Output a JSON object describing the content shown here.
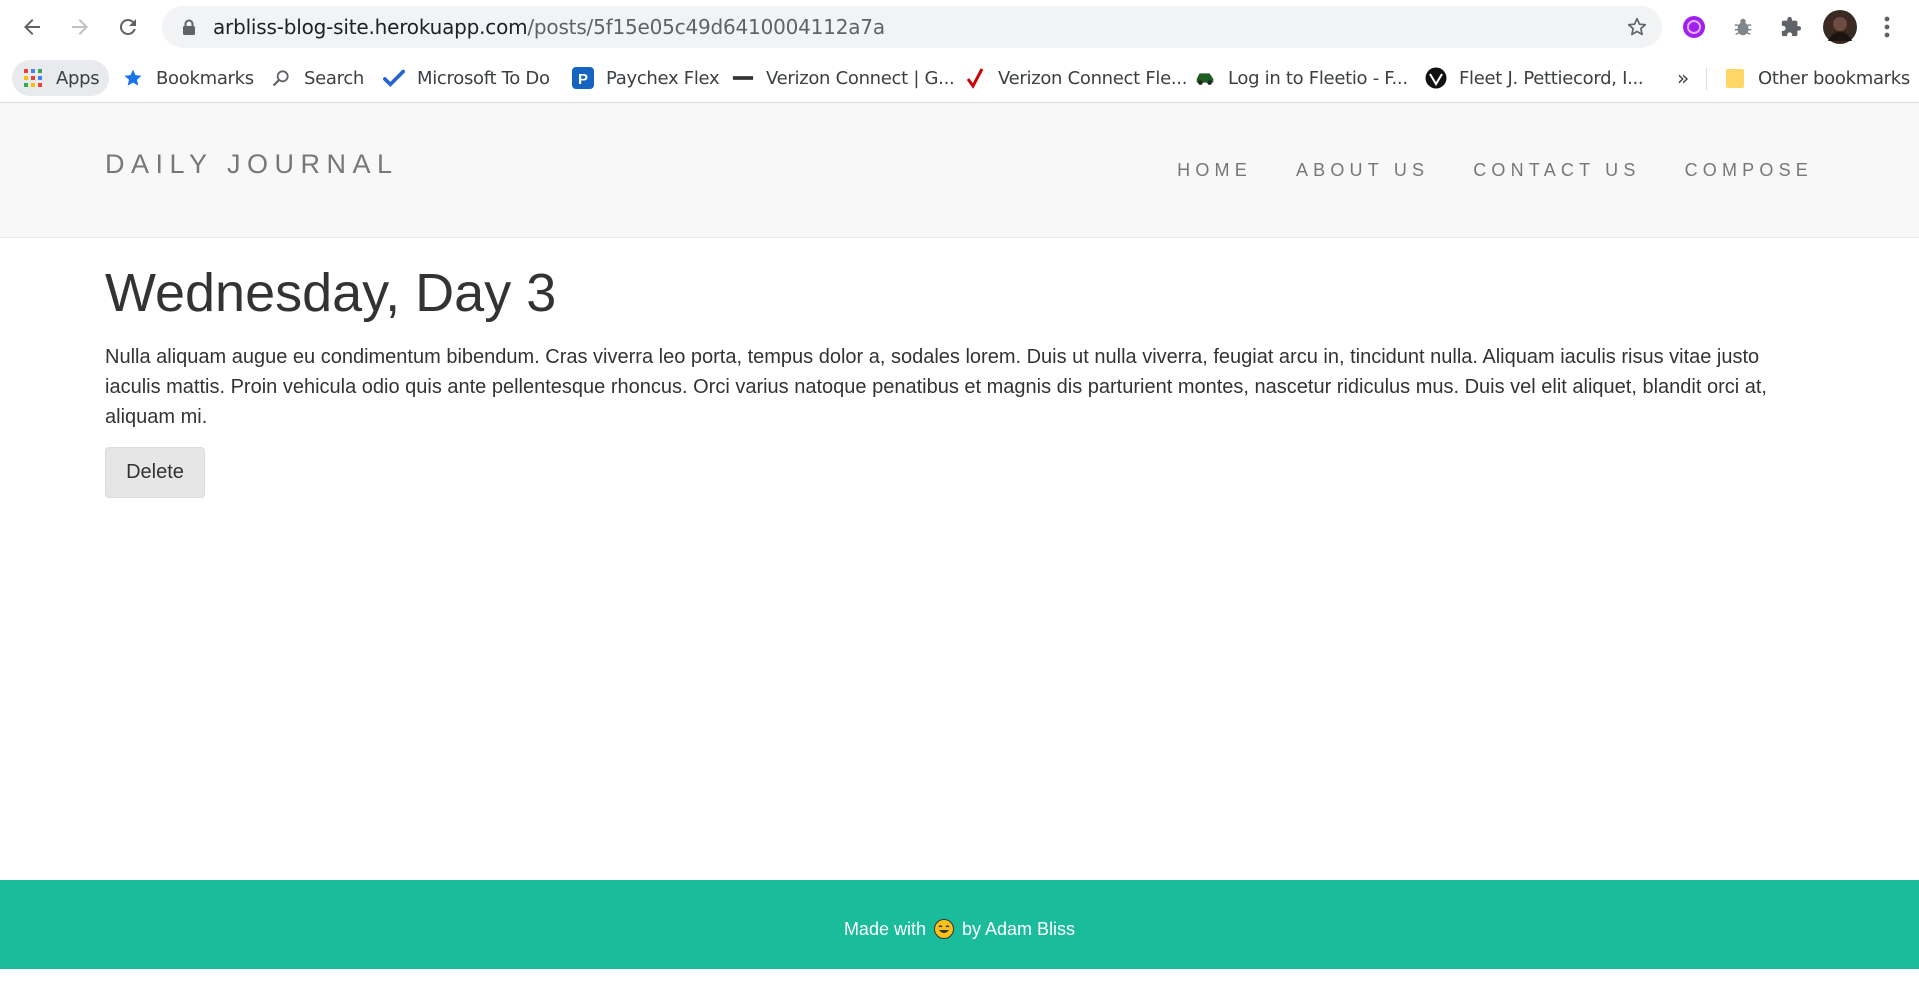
{
  "browser": {
    "url_host": "arbliss-blog-site.herokuapp.com",
    "url_path": "/posts/5f15e05c49d6410004112a7a",
    "icons": [
      "back-icon",
      "forward-icon",
      "reload-icon",
      "lock-icon",
      "star-icon",
      "extension-purple-icon",
      "bug-icon",
      "puzzle-icon",
      "avatar",
      "kebab-menu-icon"
    ]
  },
  "bookmarks": {
    "items": [
      {
        "label": "Apps",
        "icon": "apps-grid-icon"
      },
      {
        "label": "Bookmarks",
        "icon": "star-icon"
      },
      {
        "label": "Search",
        "icon": "search-icon"
      },
      {
        "label": "Microsoft To Do",
        "icon": "check-icon"
      },
      {
        "label": "Paychex Flex",
        "icon": "paychex-icon"
      },
      {
        "label": "Verizon Connect | G...",
        "icon": "verizon-icon"
      },
      {
        "label": "Verizon Connect Fle...",
        "icon": "red-check-icon"
      },
      {
        "label": "Log in to Fleetio - F...",
        "icon": "car-icon"
      },
      {
        "label": "Fleet J. Pettiecord, I...",
        "icon": "fleet-logo-icon"
      }
    ],
    "overflow": "»",
    "other": "Other bookmarks"
  },
  "site": {
    "brand": "DAILY JOURNAL",
    "nav": [
      "HOME",
      "ABOUT US",
      "CONTACT US",
      "COMPOSE"
    ]
  },
  "post": {
    "title": "Wednesday, Day 3",
    "body": "Nulla aliquam augue eu condimentum bibendum. Cras viverra leo porta, tempus dolor a, sodales lorem. Duis ut nulla viverra, feugiat arcu in, tincidunt nulla. Aliquam iaculis risus vitae justo iaculis mattis. Proin vehicula odio quis ante pellentesque rhoncus. Orci varius natoque penatibus et magnis dis parturient montes, nascetur ridiculus mus. Duis vel elit aliquet, blandit orci at, aliquam mi.",
    "delete_label": "Delete"
  },
  "footer": {
    "prefix": "Made with",
    "suffix": "by Adam Bliss",
    "accent": "#1abc9c"
  }
}
